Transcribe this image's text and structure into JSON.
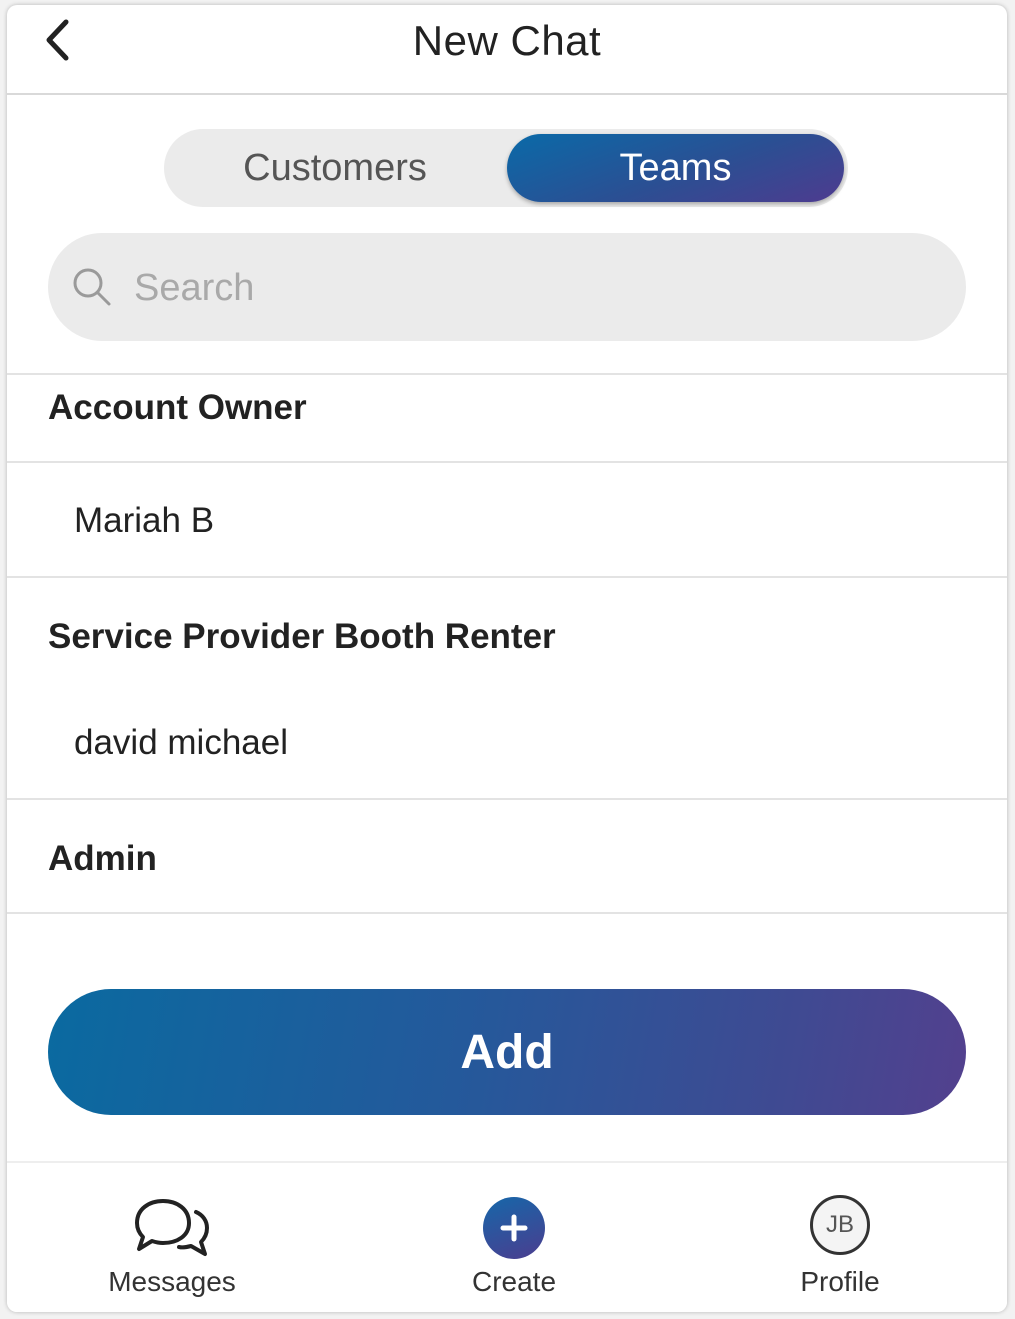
{
  "header": {
    "title": "New Chat",
    "back_icon": "chevron-left-icon"
  },
  "segment": {
    "options": [
      "Customers",
      "Teams"
    ],
    "selected": "Teams"
  },
  "search": {
    "placeholder": "Search",
    "value": "",
    "icon": "search-icon"
  },
  "sections": [
    {
      "heading": "Account Owner",
      "members": [
        "Mariah B"
      ]
    },
    {
      "heading": "Service Provider Booth Renter",
      "members": [
        "david michael"
      ]
    },
    {
      "heading": "Admin",
      "members": []
    }
  ],
  "add_button": {
    "label": "Add"
  },
  "tabbar": {
    "items": [
      {
        "label": "Messages",
        "icon": "chat-bubbles-icon"
      },
      {
        "label": "Create",
        "icon": "plus-icon"
      },
      {
        "label": "Profile",
        "icon": "avatar-icon",
        "initials": "JB"
      }
    ]
  },
  "colors": {
    "gradient_start": "#0a6aa8",
    "gradient_end": "#53408e",
    "segment_bg": "#ebebeb",
    "divider": "#e3e3e3"
  }
}
